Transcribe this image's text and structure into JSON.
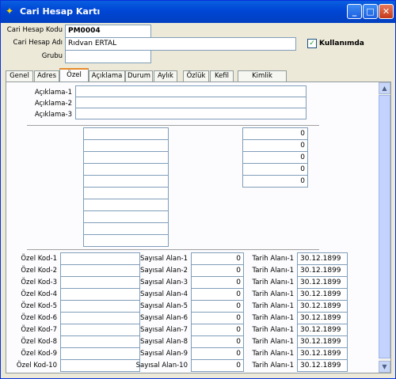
{
  "window": {
    "title": "Cari Hesap Kartı"
  },
  "header": {
    "code_label": "Cari Hesap Kodu",
    "code_value": "PM0004",
    "name_label": "Cari Hesap Adı",
    "name_value": "Rıdvan ERTAL",
    "group_label": "Grubu",
    "group_value": "",
    "active_label": "Kullanımda"
  },
  "tabs": [
    "Genel",
    "Adres",
    "Özel",
    "Açıklama",
    "Durum",
    "Aylık",
    "Özlük",
    "Kefil",
    "Kimlik Bilgileri"
  ],
  "aciklama": [
    "Açıklama-1",
    "Açıklama-2",
    "Açıklama-3"
  ],
  "right_values": [
    "0",
    "0",
    "0",
    "0",
    "0"
  ],
  "ozel_kod": [
    "Özel Kod-1",
    "Özel Kod-2",
    "Özel Kod-3",
    "Özel Kod-4",
    "Özel Kod-5",
    "Özel Kod-6",
    "Özel Kod-7",
    "Özel Kod-8",
    "Özel Kod-9",
    "Özel Kod-10"
  ],
  "sayisal": [
    "Sayısal Alan-1",
    "Sayısal Alan-2",
    "Sayısal Alan-3",
    "Sayısal Alan-4",
    "Sayısal Alan-5",
    "Sayısal Alan-6",
    "Sayısal Alan-7",
    "Sayısal Alan-8",
    "Sayısal Alan-9",
    "Sayısal Alan-10"
  ],
  "sayisal_values": [
    "0",
    "0",
    "0",
    "0",
    "0",
    "0",
    "0",
    "0",
    "0",
    "0"
  ],
  "tarih": [
    "Tarih Alanı-1",
    "Tarih Alanı-1",
    "Tarih Alanı-1",
    "Tarih Alanı-1",
    "Tarih Alanı-1",
    "Tarih Alanı-1",
    "Tarih Alanı-1",
    "Tarih Alanı-1",
    "Tarih Alanı-1",
    "Tarih Alanı-1"
  ],
  "tarih_values": [
    "30.12.1899",
    "30.12.1899",
    "30.12.1899",
    "30.12.1899",
    "30.12.1899",
    "30.12.1899",
    "30.12.1899",
    "30.12.1899",
    "30.12.1899",
    "30.12.1899"
  ]
}
